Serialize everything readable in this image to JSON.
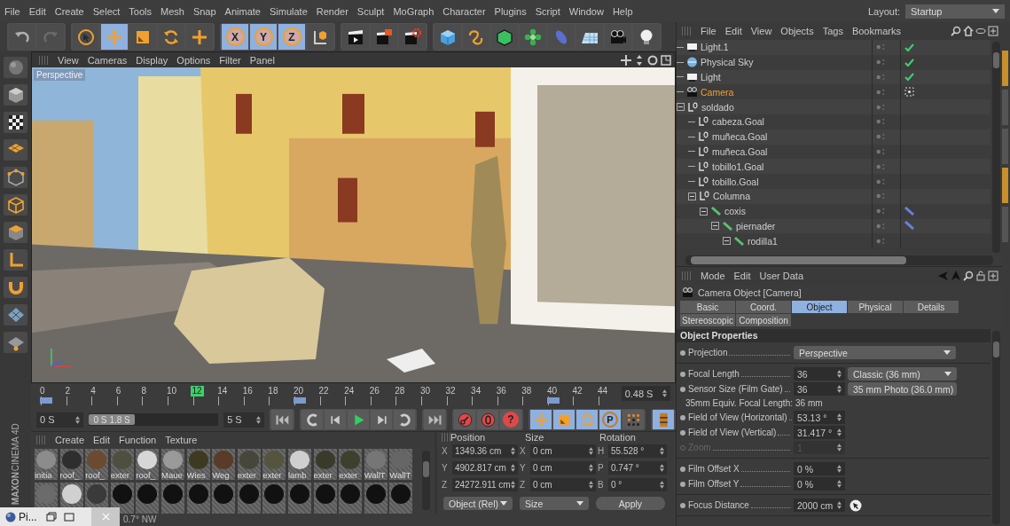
{
  "menu_bar": [
    "File",
    "Edit",
    "Create",
    "Select",
    "Tools",
    "Mesh",
    "Snap",
    "Animate",
    "Simulate",
    "Render",
    "Sculpt",
    "MoGraph",
    "Character",
    "Plugins",
    "Script",
    "Window",
    "Help"
  ],
  "layout": {
    "label": "Layout:",
    "value": "Startup"
  },
  "toolbar": [
    [
      {
        "kind": "undo",
        "selected": false,
        "disabled": false
      },
      {
        "kind": "redo",
        "selected": false,
        "disabled": true
      }
    ],
    [
      {
        "kind": "select",
        "selected": false,
        "disabled": false
      },
      {
        "kind": "move",
        "selected": true,
        "disabled": false
      },
      {
        "kind": "scale",
        "selected": false,
        "disabled": false
      },
      {
        "kind": "rotate",
        "selected": false,
        "disabled": false
      },
      {
        "kind": "recent",
        "selected": false,
        "disabled": false
      }
    ],
    [
      {
        "kind": "axis",
        "label": "X",
        "selected": true,
        "disabled": false
      },
      {
        "kind": "axis",
        "label": "Y",
        "selected": true,
        "disabled": false
      },
      {
        "kind": "axis",
        "label": "Z",
        "selected": true,
        "disabled": false
      },
      {
        "kind": "coords",
        "selected": false,
        "disabled": false
      }
    ],
    [
      {
        "kind": "render_view",
        "selected": false,
        "disabled": false
      },
      {
        "kind": "render_pv",
        "selected": false,
        "disabled": false
      },
      {
        "kind": "render_settings",
        "selected": false,
        "disabled": false
      }
    ],
    [
      {
        "kind": "cube",
        "selected": false,
        "disabled": false
      },
      {
        "kind": "spline",
        "selected": false,
        "disabled": false
      },
      {
        "kind": "nurbs",
        "selected": false,
        "disabled": false
      },
      {
        "kind": "array",
        "selected": false,
        "disabled": false
      },
      {
        "kind": "deformer",
        "selected": false,
        "disabled": false
      },
      {
        "kind": "floor",
        "selected": false,
        "disabled": false
      },
      {
        "kind": "camera",
        "selected": false,
        "disabled": false
      },
      {
        "kind": "light",
        "selected": false,
        "disabled": false
      }
    ]
  ],
  "viewport": {
    "menu": [
      "View",
      "Cameras",
      "Display",
      "Options",
      "Filter",
      "Panel"
    ],
    "camera_label": "Perspective"
  },
  "timeline": {
    "ticks": [
      {
        "label": "0",
        "selected": false,
        "marker": true
      },
      {
        "label": "2",
        "selected": false,
        "marker": false
      },
      {
        "label": "4",
        "selected": false,
        "marker": false
      },
      {
        "label": "6",
        "selected": false,
        "marker": false
      },
      {
        "label": "8",
        "selected": false,
        "marker": false
      },
      {
        "label": "10",
        "selected": false,
        "marker": false
      },
      {
        "label": "12",
        "selected": true,
        "marker": false
      },
      {
        "label": "14",
        "selected": false,
        "marker": false
      },
      {
        "label": "16",
        "selected": false,
        "marker": false
      },
      {
        "label": "18",
        "selected": false,
        "marker": false
      },
      {
        "label": "20",
        "selected": false,
        "marker": true
      },
      {
        "label": "22",
        "selected": false,
        "marker": false
      },
      {
        "label": "24",
        "selected": false,
        "marker": false
      },
      {
        "label": "26",
        "selected": false,
        "marker": false
      },
      {
        "label": "28",
        "selected": false,
        "marker": false
      },
      {
        "label": "30",
        "selected": false,
        "marker": false
      },
      {
        "label": "32",
        "selected": false,
        "marker": false
      },
      {
        "label": "34",
        "selected": false,
        "marker": false
      },
      {
        "label": "36",
        "selected": false,
        "marker": false
      },
      {
        "label": "38",
        "selected": false,
        "marker": false
      },
      {
        "label": "40",
        "selected": false,
        "marker": true
      },
      {
        "label": "42",
        "selected": false,
        "marker": false
      },
      {
        "label": "44",
        "selected": false,
        "marker": false
      }
    ],
    "time": "0.48 S"
  },
  "transport": {
    "start": "0 S",
    "range_start": "0 S",
    "range_end": "1.8 S",
    "end": "5 S",
    "range": {
      "level": 0.36
    },
    "buttons": [
      [
        {
          "kind": "first",
          "selected": false
        }
      ],
      [
        {
          "kind": "prev_key",
          "selected": false
        },
        {
          "kind": "prev_frame",
          "selected": false
        },
        {
          "kind": "play",
          "selected": false
        },
        {
          "kind": "next_frame",
          "selected": false
        },
        {
          "kind": "next_key",
          "selected": false
        }
      ],
      [
        {
          "kind": "last",
          "selected": false
        }
      ],
      [
        {
          "kind": "record",
          "selected": false
        },
        {
          "kind": "autokey",
          "selected": false
        },
        {
          "kind": "help",
          "label": "?",
          "selected": false
        }
      ],
      [
        {
          "kind": "move",
          "selected": true
        },
        {
          "kind": "scale",
          "selected": true
        },
        {
          "kind": "rotate",
          "selected": true
        },
        {
          "kind": "param",
          "label": "P",
          "selected": true
        },
        {
          "kind": "points",
          "selected": false
        }
      ],
      [
        {
          "kind": "timeline",
          "selected": true
        }
      ]
    ]
  },
  "logo": {
    "brand": "MAXON",
    "product": "CINEMA 4D"
  },
  "materials": {
    "menu": [
      "Create",
      "Edit",
      "Function",
      "Texture"
    ],
    "items": [
      {
        "name": "initia",
        "color": "#8c8c8c"
      },
      {
        "name": "roof_",
        "color": "#2e2e2e"
      },
      {
        "name": "roof_",
        "color": "#6b4a30"
      },
      {
        "name": "exter",
        "color": "#4f4f40"
      },
      {
        "name": "roof_",
        "color": "#d6d6d6"
      },
      {
        "name": "Maue",
        "color": "#9a9a9a"
      },
      {
        "name": "Wies",
        "color": "#3e3a22"
      },
      {
        "name": "Weg",
        "color": "#5a3a28"
      },
      {
        "name": "exter",
        "color": "#46463a"
      },
      {
        "name": "exter",
        "color": "#55553f"
      },
      {
        "name": "lamb",
        "color": "#cfcfcf"
      },
      {
        "name": "exter",
        "color": "#3a3a2a"
      },
      {
        "name": "exter",
        "color": "#3f3f2e"
      },
      {
        "name": "WallT",
        "color": "#767676"
      },
      {
        "name": "WallT",
        "color": "#666666"
      },
      {
        "color": "#6b6b6b"
      },
      {
        "color": "#d0d0d0"
      },
      {
        "color": "#3a3a3a"
      },
      {
        "color": "#111111"
      },
      {
        "color": "#111111"
      },
      {
        "color": "#111111"
      },
      {
        "color": "#111111"
      },
      {
        "color": "#111111"
      },
      {
        "color": "#111111"
      },
      {
        "color": "#111111"
      },
      {
        "color": "#111111"
      },
      {
        "color": "#111111"
      },
      {
        "color": "#111111"
      },
      {
        "color": "#111111"
      },
      {
        "color": "#111111"
      }
    ]
  },
  "coordinates": {
    "headers": [
      "Position",
      "Size",
      "Rotation"
    ],
    "rows": [
      {
        "axis": "X",
        "position": "1349.36 cm",
        "size_axis": "X",
        "size": "0 cm",
        "rotation_axis": "H",
        "rotation": "55.528 °"
      },
      {
        "axis": "Y",
        "position": "4902.817 cm",
        "size_axis": "Y",
        "size": "0 cm",
        "rotation_axis": "P",
        "rotation": "0.747 °"
      },
      {
        "axis": "Z",
        "position": "24272.911 cm",
        "size_axis": "Z",
        "size": "0 cm",
        "rotation_axis": "B",
        "rotation": "0 °"
      }
    ],
    "mode": "Object (Rel)",
    "size_mode": "Size",
    "apply": "Apply"
  },
  "status": "0.7° NW",
  "taskbar_preview": {
    "title": "Pi..."
  },
  "objects": {
    "menu": [
      "File",
      "Edit",
      "View",
      "Objects",
      "Tags",
      "Bookmarks"
    ],
    "tree": [
      {
        "name": "Light.1",
        "kind": "light",
        "selected": false,
        "tag": {
          "kind": "check"
        }
      },
      {
        "name": "Physical Sky",
        "kind": "sky",
        "selected": false,
        "tag": {
          "kind": "check"
        }
      },
      {
        "name": "Light",
        "kind": "light",
        "selected": false,
        "tag": {
          "kind": "check"
        }
      },
      {
        "name": "Camera",
        "kind": "camera",
        "selected": true,
        "tag": {
          "kind": "target"
        }
      },
      {
        "name": "soldado",
        "kind": "null",
        "selected": false,
        "expanded": true,
        "children": [
          {
            "name": "cabeza.Goal",
            "kind": "null",
            "selected": false
          },
          {
            "name": "muñeca.Goal",
            "kind": "null",
            "selected": false
          },
          {
            "name": "muñeca.Goal",
            "kind": "null",
            "selected": false
          },
          {
            "name": "tobillo1.Goal",
            "kind": "null",
            "selected": false
          },
          {
            "name": "tobillo.Goal",
            "kind": "null",
            "selected": false
          },
          {
            "name": "Columna",
            "kind": "null",
            "selected": false,
            "expanded": true,
            "children": [
              {
                "name": "coxis",
                "kind": "joint",
                "selected": false,
                "tag": {
                  "kind": "ik"
                },
                "expanded": true,
                "children": [
                  {
                    "name": "piernader",
                    "kind": "joint",
                    "selected": false,
                    "tag": {
                      "kind": "ik"
                    },
                    "expanded": true,
                    "children": [
                      {
                        "name": "rodilla1",
                        "kind": "joint",
                        "selected": false,
                        "expanded": true
                      }
                    ]
                  }
                ]
              }
            ]
          }
        ]
      }
    ]
  },
  "attributes": {
    "menu": [
      "Mode",
      "Edit",
      "User Data"
    ],
    "title": "Camera Object [Camera]",
    "tabs": [
      {
        "label": "Basic",
        "selected": false
      },
      {
        "label": "Coord.",
        "selected": false
      },
      {
        "label": "Object",
        "selected": true
      },
      {
        "label": "Physical",
        "selected": false
      },
      {
        "label": "Details",
        "selected": false
      },
      {
        "label": "Stereoscopic",
        "selected": false
      },
      {
        "label": "Composition",
        "selected": false
      }
    ],
    "section": "Object Properties",
    "groups": [
      [
        {
          "kind": "dropdown",
          "label": "Projection",
          "value": "Perspective",
          "disabled": false
        }
      ],
      [
        {
          "kind": "number_dropdown",
          "label": "Focal Length",
          "value": "36",
          "option": "Classic (36 mm)",
          "disabled": false
        },
        {
          "kind": "number_dropdown",
          "label": "Sensor Size (Film Gate)",
          "value": "36",
          "option": "35 mm Photo (36.0 mm)",
          "disabled": false
        },
        {
          "kind": "info",
          "label": "35mm Equiv. Focal Length:",
          "value": "36 mm",
          "disabled": false
        },
        {
          "kind": "number",
          "label": "Field of View (Horizontal)",
          "value": "53.13 °",
          "disabled": false
        },
        {
          "kind": "number",
          "label": "Field of View (Vertical)",
          "value": "31.417 °",
          "disabled": false
        },
        {
          "kind": "number",
          "label": "Zoom",
          "value": "1",
          "disabled": true
        }
      ],
      [
        {
          "kind": "number",
          "label": "Film Offset X",
          "value": "0 %",
          "disabled": false
        },
        {
          "kind": "number",
          "label": "Film Offset Y",
          "value": "0 %",
          "disabled": false
        }
      ],
      [
        {
          "kind": "number_picker",
          "label": "Focus Distance",
          "value": "2000 cm",
          "disabled": false
        }
      ]
    ]
  }
}
